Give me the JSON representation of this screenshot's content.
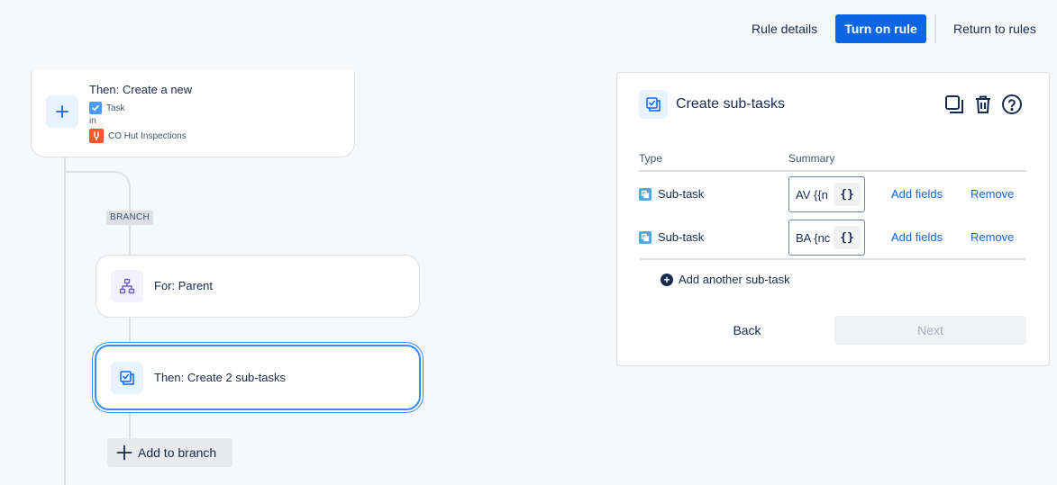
{
  "topbar": {
    "rule_details": "Rule details",
    "turn_on": "Turn on rule",
    "return_rules": "Return to rules"
  },
  "canvas": {
    "create_node": {
      "title": "Then: Create a new",
      "issue_type": "Task",
      "in_label": "in",
      "project": "CO Hut Inspections"
    },
    "branch_tag": "BRANCH",
    "parent_node": {
      "label": "For: Parent"
    },
    "subtask_node": {
      "label": "Then: Create 2 sub-tasks"
    },
    "add_branch": "Add to branch"
  },
  "panel": {
    "title": "Create sub-tasks",
    "col_type": "Type",
    "col_summary": "Summary",
    "rows": [
      {
        "type": "Sub-task",
        "summary": "AV {{n",
        "brace": "{}",
        "add_fields": "Add fields",
        "remove": "Remove"
      },
      {
        "type": "Sub-task",
        "summary": "BA {nc",
        "brace": "{}",
        "add_fields": "Add fields",
        "remove": "Remove"
      }
    ],
    "add_another": "Add another sub-task",
    "back": "Back",
    "next": "Next"
  },
  "colors": {
    "primary": "#0c66e4",
    "selected_border": "#388bff",
    "line": "#dcdfe4"
  }
}
